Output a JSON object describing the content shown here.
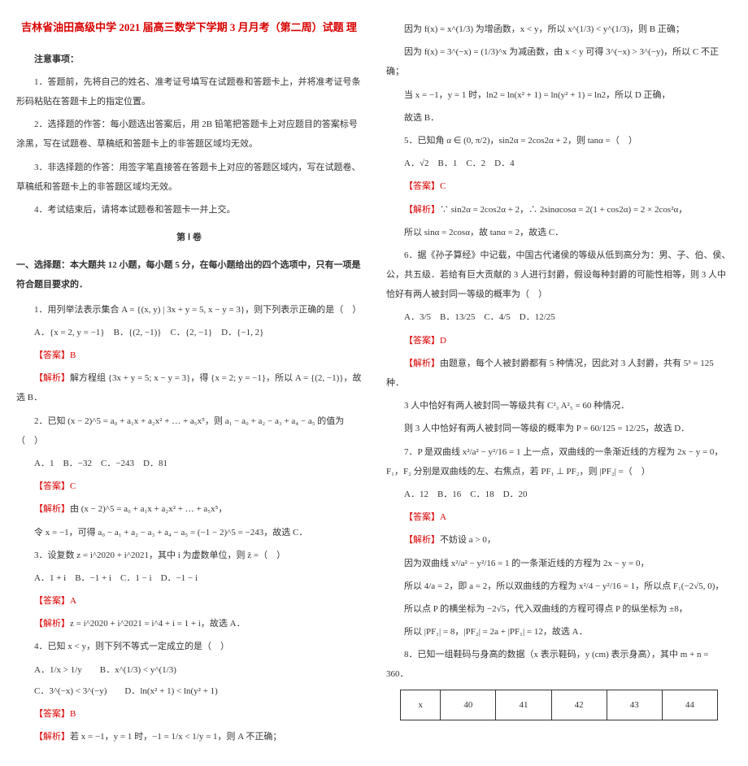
{
  "title_main": "吉林省油田高级中学 2021 届高三数学下学期 3 月月考（第二周）试题 理",
  "notice_heading": "注意事项：",
  "notice": [
    "1．答题前，先将自己的姓名、准考证号填写在试题卷和答题卡上，并将准考证号条形码粘贴在答题卡上的指定位置。",
    "2．选择题的作答：每小题选出答案后，用 2B 铅笔把答题卡上对应题目的答案标号涂黑，写在试题卷、草稿纸和答题卡上的非答题区域均无效。",
    "3．非选择题的作答：用签字笔直接答在答题卡上对应的答题区域内，写在试题卷、草稿纸和答题卡上的非答题区域均无效。",
    "4．考试结束后，请将本试题卷和答题卡一并上交。"
  ],
  "part1_label": "第 Ⅰ 卷",
  "sectionA": "一、选择题：本大题共 12 小题，每小题 5 分，在每小题给出的四个选项中，只有一项是符合题目要求的．",
  "q1": {
    "stem": "1．用列举法表示集合 A = {(x, y) | 3x + y = 5, x − y = 3}，则下列表示正确的是（　）",
    "opts": "A．{x = 2, y = −1}　B．{(2, −1)}　C．{2, −1}　D．{−1, 2}",
    "ans": "【答案】B",
    "exp": "解方程组 {3x + y = 5; x − y = 3}，得 {x = 2; y = −1}，所以 A = {(2, −1)}，故选 B．"
  },
  "q2": {
    "stem": "2．已知 (x − 2)^5 = a₀ + a₁x + a₂x² + … + a₅x⁵，则 a₁ − a₀ + a₂ − a₃ + a₄ − a₅ 的值为（　）",
    "opts": "A．1　B．−32　C．−243　D．81",
    "ans": "【答案】C",
    "exp1": "由 (x − 2)^5 = a₀ + a₁x + a₂x² + … + a₅x⁵，",
    "exp2": "令 x = −1，可得 a₀ − a₁ + a₂ − a₃ + a₄ − a₅ = (−1 − 2)^5 = −243，故选 C．"
  },
  "q3": {
    "stem": "3．设复数 z = i^2020 + i^2021，其中 i 为虚数单位，则 z̄ =（　）",
    "opts": "A．1 + i　B．−1 + i　C．1 − i　D．−1 − i",
    "ans": "【答案】A",
    "exp": "z = i^2020 + i^2021 = i^4 + i = 1 + i，故选 A．"
  },
  "q4": {
    "stem": "4．已知 x < y，则下列不等式一定成立的是（　）",
    "opts1": "A．1/x > 1/y　　B．x^(1/3) < y^(1/3)",
    "opts2": "C．3^(−x) < 3^(−y)　　D．ln(x² + 1) < ln(y² + 1)",
    "ans": "【答案】B",
    "exp": "若 x = −1，y = 1 时，−1 = 1/x < 1/y = 1，则 A 不正确；"
  },
  "col2_top": [
    "因为 f(x) = x^(1/3) 为增函数，x < y，所以 x^(1/3) < y^(1/3)，则 B 正确；",
    "因为 f(x) = 3^(−x) = (1/3)^x 为减函数，由 x < y 可得 3^(−x) > 3^(−y)，所以 C 不正确；",
    "当 x = −1，y = 1 时，ln2 = ln(x² + 1) = ln(y² + 1) = ln2，所以 D 正确，",
    "故选 B．"
  ],
  "q5": {
    "stem": "5．已知角 α ∈ (0, π/2)，sin2α = 2cos2α + 2，则 tanα =（　）",
    "opts": "A．√2　B．1　C．2　D．4",
    "ans": "【答案】C",
    "exp1": "∵ sin2α = 2cos2α + 2，∴ 2sinαcosα = 2(1 + cos2α) = 2 × 2cos²α，",
    "exp2": "所以 sinα = 2cosα，故 tanα = 2，故选 C．"
  },
  "q6": {
    "stem": "6．据《孙子算经》中记载，中国古代诸侯的等级从低到高分为：男、子、伯、侯、公，共五级．若给有巨大贡献的 3 人进行封爵，假设每种封爵的可能性相等，则 3 人中恰好有两人被封同一等级的概率为（　）",
    "opts": "A．3/5　B．13/25　C．4/5　D．12/25",
    "ans": "【答案】D",
    "exp1": "由题意，每个人被封爵都有 5 种情况，因此对 3 人封爵，共有 5³ = 125 种．",
    "exp2": "3 人中恰好有两人被封同一等级共有 C²₃ A²₅ = 60 种情况．",
    "exp3": "则 3 人中恰好有两人被封同一等级的概率为 P = 60/125 = 12/25，故选 D．"
  },
  "q7": {
    "stem": "7．P 是双曲线 x²/a² − y²/16 = 1 上一点，双曲线的一条渐近线的方程为 2x − y = 0，F₁，F₂ 分别是双曲线的左、右焦点，若 PF₁ ⊥ PF₂，则 |PF₂| =（　）",
    "opts": "A．12　B．16　C．18　D．20",
    "ans": "【答案】A",
    "exp1": "不妨设 a > 0，",
    "exp2": "因为双曲线 x²/a² − y²/16 = 1 的一条渐近线的方程为 2x − y = 0，",
    "exp3": "所以 4/a = 2，即 a = 2，所以双曲线的方程为 x²/4 − y²/16 = 1，所以点 F₁(−2√5, 0)，",
    "exp4": "所以点 P 的横坐标为 −2√5，代入双曲线的方程可得点 P 的纵坐标为 ±8，",
    "exp5": "所以 |PF₁| = 8，|PF₂| = 2a + |PF₁| = 12，故选 A．"
  },
  "q8": {
    "stem": "8．已知一组鞋码与身高的数据（x 表示鞋码，y (cm) 表示身高），其中 m + n = 360．",
    "table": {
      "header": [
        "x",
        "40",
        "41",
        "42",
        "43",
        "44"
      ]
    }
  }
}
